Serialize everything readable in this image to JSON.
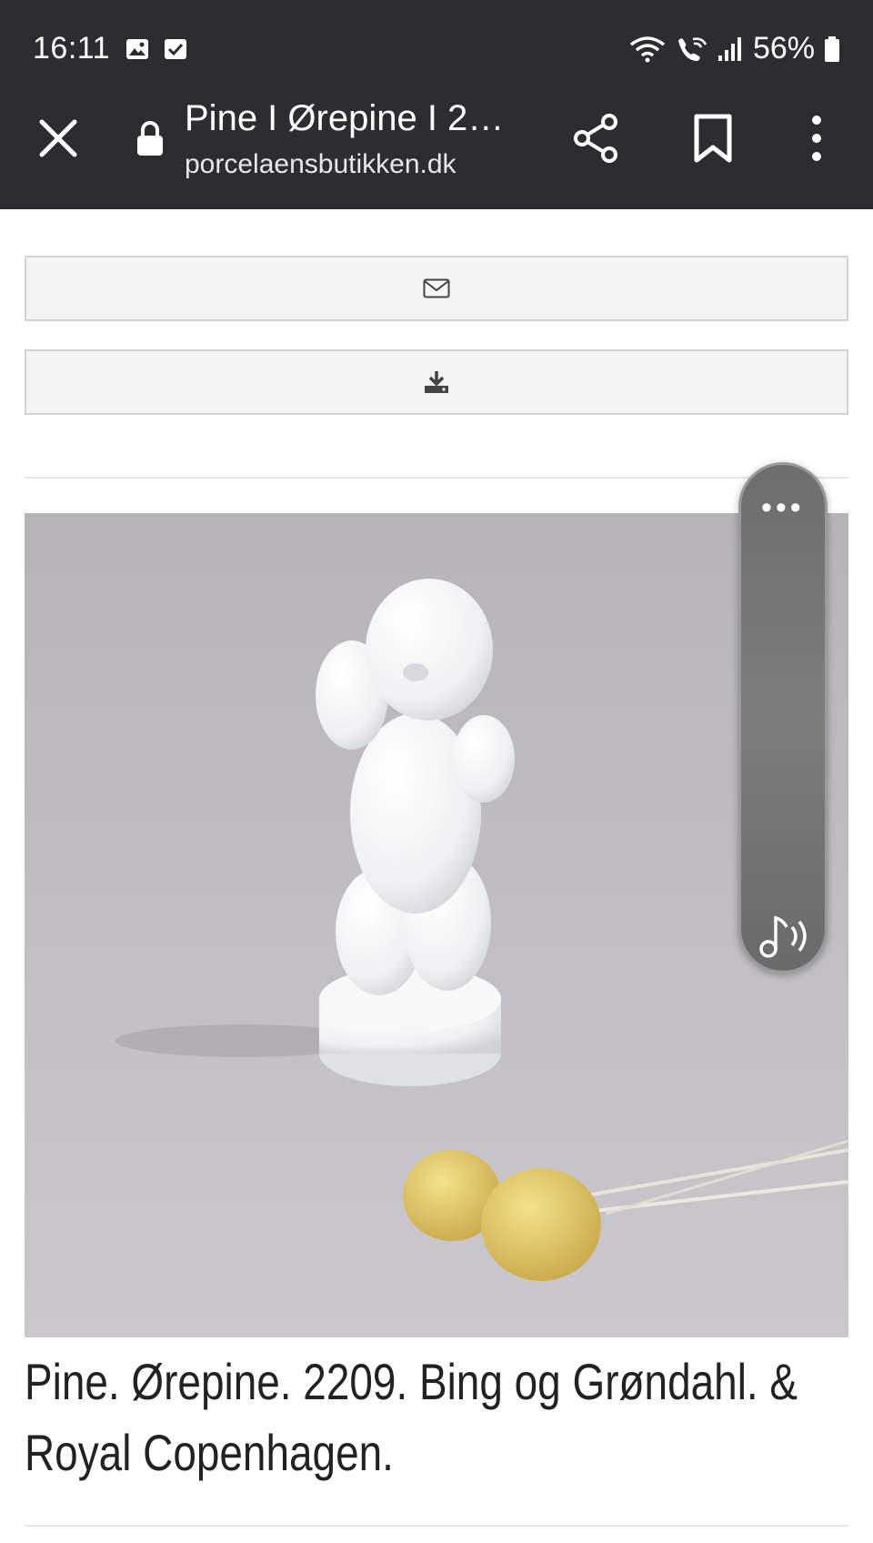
{
  "status_bar": {
    "time": "16:11",
    "battery": "56%",
    "icons": [
      "gallery-icon",
      "checkbox-icon",
      "wifi-icon",
      "wifi-calling-icon",
      "signal-icon",
      "battery-icon"
    ]
  },
  "browser": {
    "page_title": "Pine I Ørepine I 2…",
    "url": "porcelaensbutikken.dk",
    "icons": [
      "close-icon",
      "lock-icon",
      "share-icon",
      "bookmark-icon",
      "more-vert-icon"
    ]
  },
  "actions": {
    "email_icon": "envelope-icon",
    "download_icon": "download-icon"
  },
  "product": {
    "caption": "Pine. Ørepine. 2209. Bing og Grøndahl. & Royal Copenhagen."
  },
  "floating_panel": {
    "menu_dots": "•••",
    "icon": "music-sound-icon"
  }
}
